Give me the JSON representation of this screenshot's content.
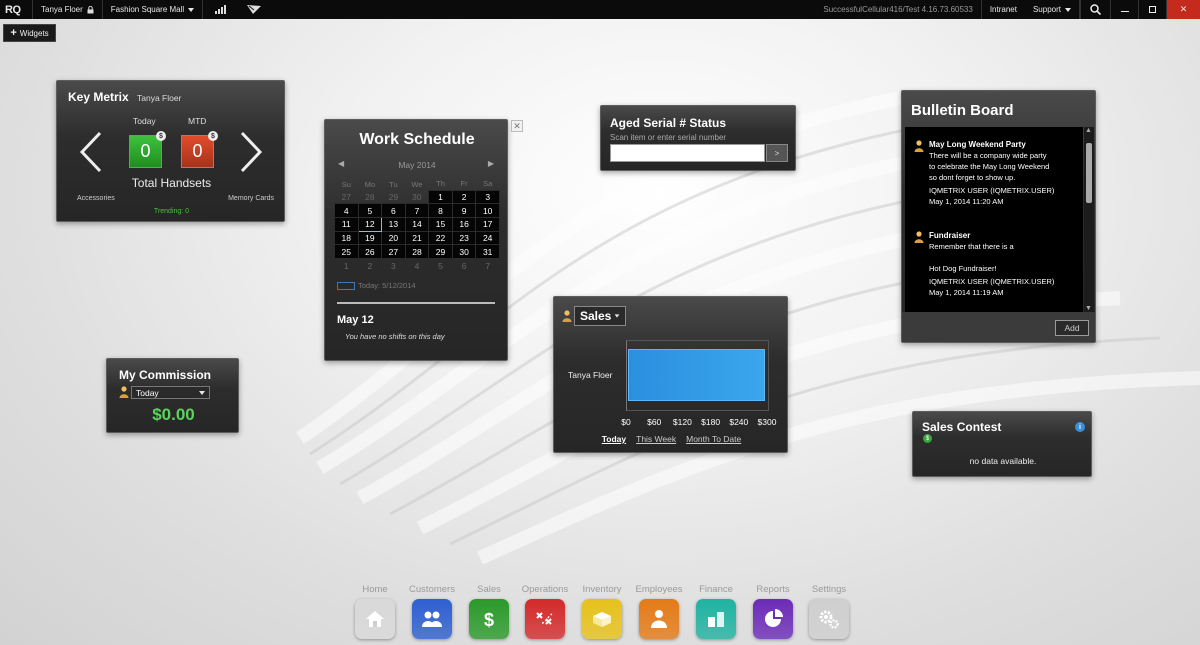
{
  "topbar": {
    "logo": "RQ",
    "user": "Tanya Floer",
    "location": "Fashion Square Mall",
    "version": "SuccessfulCellular416/Test 4.16.73.60533",
    "intranet": "Intranet",
    "support": "Support"
  },
  "widgets_button": "Widgets",
  "key_metrix": {
    "title": "Key Metrix",
    "user": "Tanya Floer",
    "today_label": "Today",
    "mtd_label": "MTD",
    "today_value": "0",
    "mtd_value": "0",
    "metric": "Total Handsets",
    "prev": "Accessories",
    "next": "Memory Cards",
    "trending": "Trending: 0"
  },
  "work_schedule": {
    "title": "Work Schedule",
    "month": "May 2014",
    "weekdays": [
      "Su",
      "Mo",
      "Tu",
      "We",
      "Th",
      "Fr",
      "Sa"
    ],
    "weeks": [
      [
        "27",
        "28",
        "29",
        "30",
        "1",
        "2",
        "3"
      ],
      [
        "4",
        "5",
        "6",
        "7",
        "8",
        "9",
        "10"
      ],
      [
        "11",
        "12",
        "13",
        "14",
        "15",
        "16",
        "17"
      ],
      [
        "18",
        "19",
        "20",
        "21",
        "22",
        "23",
        "24"
      ],
      [
        "25",
        "26",
        "27",
        "28",
        "29",
        "30",
        "31"
      ],
      [
        "1",
        "2",
        "3",
        "4",
        "5",
        "6",
        "7"
      ]
    ],
    "today_text": "Today: 5/12/2014",
    "selected_date": "May 12",
    "no_shifts": "You have no shifts on this day"
  },
  "commission": {
    "title": "My Commission",
    "period": "Today",
    "amount": "$0.00"
  },
  "aged_serial": {
    "title": "Aged Serial # Status",
    "hint": "Scan item or enter serial number",
    "input_value": "",
    "go_label": ">"
  },
  "sales": {
    "selector": "Sales",
    "tabs": [
      "Today",
      "This Week",
      "Month To Date"
    ],
    "active_tab": "Today"
  },
  "chart_data": {
    "type": "bar",
    "orientation": "horizontal",
    "categories": [
      "Tanya Floer"
    ],
    "values": [
      300
    ],
    "xlim": [
      0,
      300
    ],
    "xticks": [
      "$0",
      "$60",
      "$120",
      "$180",
      "$240",
      "$300"
    ],
    "color": "#2b8fe0"
  },
  "bulletin": {
    "title": "Bulletin Board",
    "posts": [
      {
        "title": "May Long Weekend Party",
        "body": [
          "There will be a company wide party",
          "to celebrate the May Long Weekend",
          "so dont forget to show up."
        ],
        "author": "IQMETRIX USER (IQMETRIX.USER)",
        "date": "May 1, 2014 11:20 AM"
      },
      {
        "title": "Fundraiser",
        "body": [
          "Remember that there is a",
          "",
          "Hot Dog Fundraiser!"
        ],
        "author": "IQMETRIX USER (IQMETRIX.USER)",
        "date": "May 1, 2014 11:19 AM"
      }
    ],
    "add_label": "Add"
  },
  "sales_contest": {
    "title": "Sales Contest",
    "empty": "no data available."
  },
  "dock": [
    {
      "label": "Home",
      "icon": "home-icon",
      "color": "#d9d9d9"
    },
    {
      "label": "Customers",
      "icon": "customers-icon",
      "color": "#2d5fd1"
    },
    {
      "label": "Sales",
      "icon": "dollar-icon",
      "color": "#2a9a2a"
    },
    {
      "label": "Operations",
      "icon": "operations-icon",
      "color": "#d42a2a"
    },
    {
      "label": "Inventory",
      "icon": "inventory-icon",
      "color": "#e7c21a"
    },
    {
      "label": "Employees",
      "icon": "employee-icon",
      "color": "#e47a16"
    },
    {
      "label": "Finance",
      "icon": "finance-icon",
      "color": "#1fb3a1"
    },
    {
      "label": "Reports",
      "icon": "pie-chart-icon",
      "color": "#6b2bb8"
    },
    {
      "label": "Settings",
      "icon": "gears-icon",
      "color": "#cfcfcf"
    }
  ]
}
